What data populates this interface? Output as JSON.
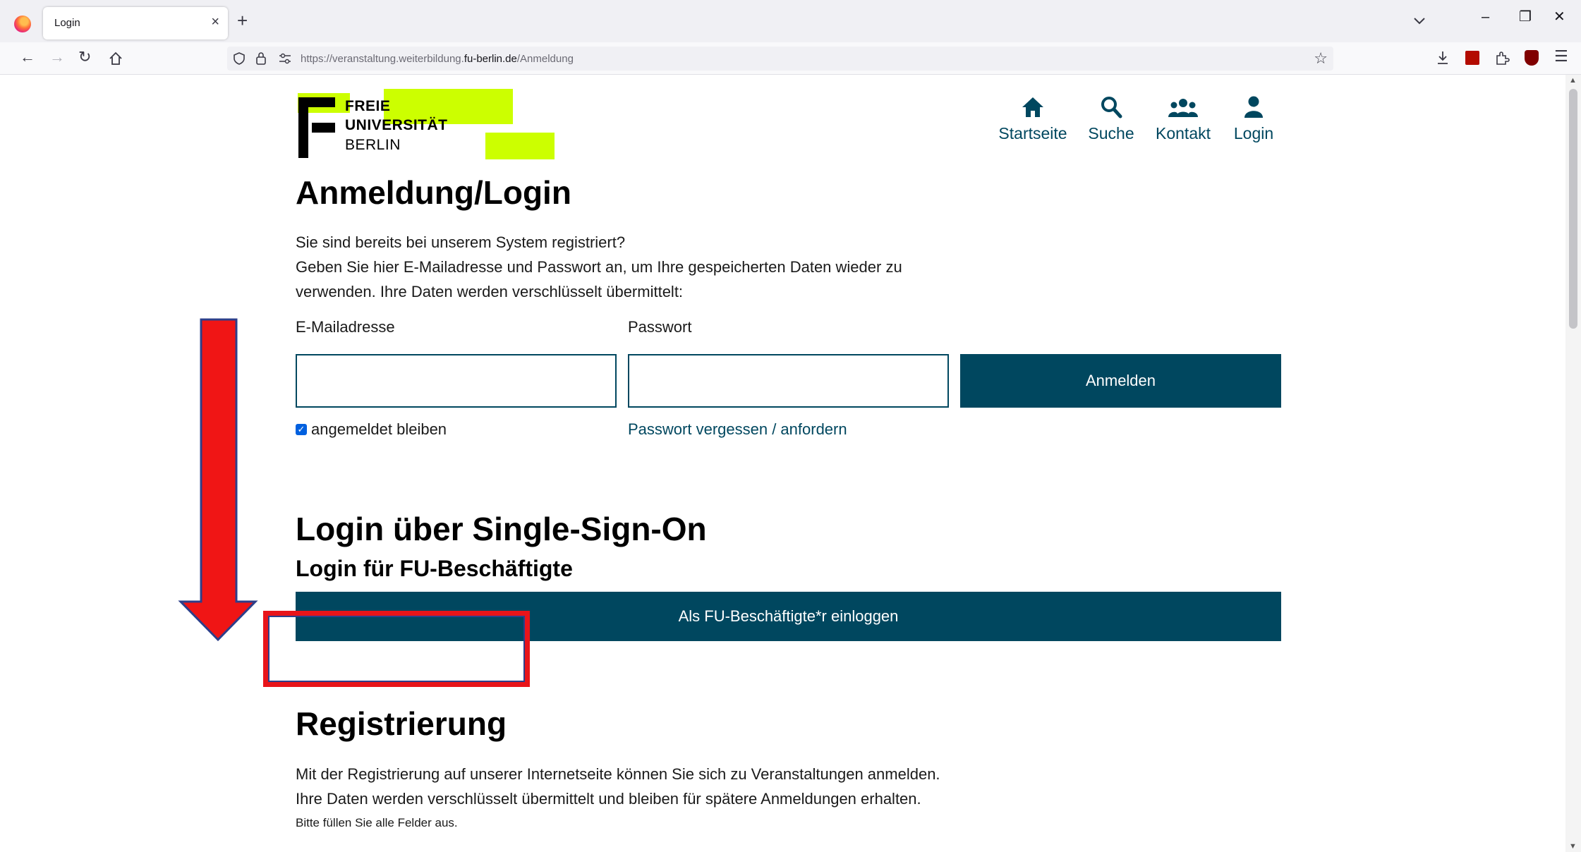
{
  "browser": {
    "tab_title": "Login",
    "tab_close": "×",
    "new_tab": "+",
    "url_prefix": "https://veranstaltung.weiterbildung.",
    "url_host": "fu-berlin.de",
    "url_path": "/Anmeldung"
  },
  "logo": {
    "line1": "FREIE",
    "line2": "UNIVERSITÄT",
    "line3": "BERLIN",
    "highlight_color": "#ccff00"
  },
  "topnav": [
    {
      "label": "Startseite",
      "icon": "home-icon"
    },
    {
      "label": "Suche",
      "icon": "search-icon"
    },
    {
      "label": "Kontakt",
      "icon": "users-icon"
    },
    {
      "label": "Login",
      "icon": "user-icon"
    }
  ],
  "login": {
    "title": "Anmeldung/Login",
    "intro_line1": "Sie sind bereits bei unserem System registriert?",
    "intro_line2": "Geben Sie hier E-Mailadresse und Passwort an, um Ihre gespeicherten Daten wieder zu",
    "intro_line3": "verwenden. Ihre Daten werden verschlüsselt übermittelt:",
    "email_label": "E-Mailadresse",
    "password_label": "Passwort",
    "email_value": "",
    "password_value": "",
    "submit_label": "Anmelden",
    "remember_label": "angemeldet bleiben",
    "remember_checked": true,
    "forgot_link": "Passwort vergessen / anfordern"
  },
  "sso": {
    "title": "Login über Single-Sign-On",
    "subtitle": "Login für FU-Beschäftigte",
    "button_label": "Als FU-Beschäftigte*r einloggen"
  },
  "registration": {
    "title": "Registrierung",
    "line1": "Mit der Registrierung auf unserer Internetseite können Sie sich zu Veranstaltungen anmelden.",
    "line2": "Ihre Daten werden verschlüsselt übermittelt und bleiben für spätere Anmeldungen erhalten.",
    "note": "Bitte füllen Sie alle Felder aus."
  },
  "colors": {
    "brand": "#00475f",
    "annotation": "#e8141a"
  }
}
